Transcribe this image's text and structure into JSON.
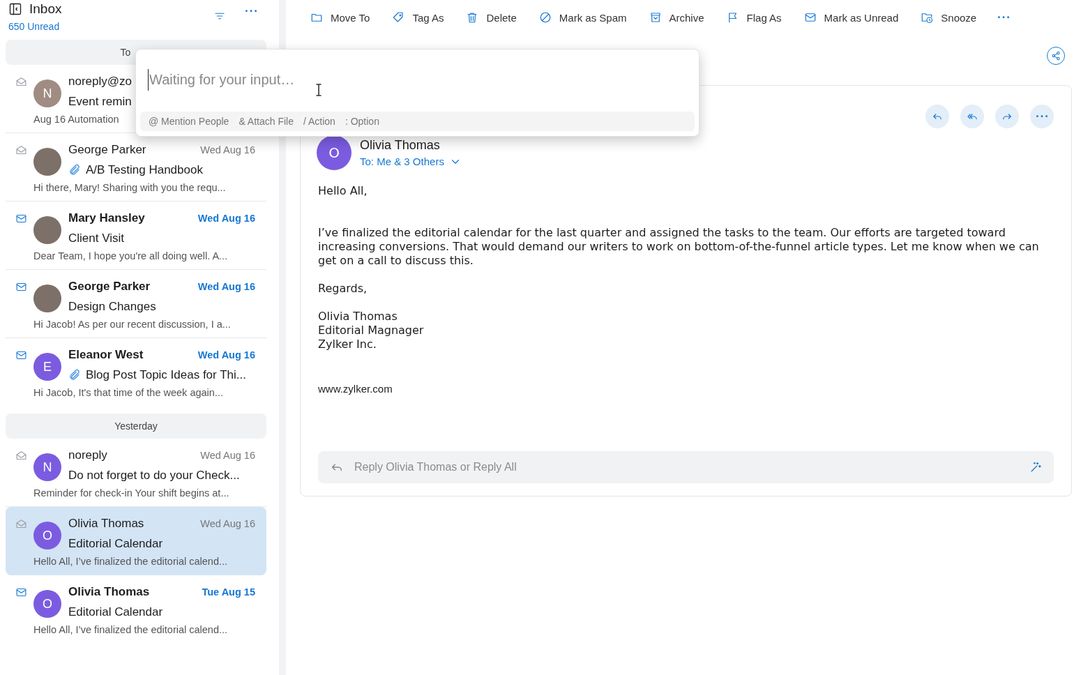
{
  "header": {
    "title": "Inbox",
    "unread": "650 Unread"
  },
  "groups": [
    {
      "label": "To",
      "emails": [
        {
          "sender": "noreply@zo",
          "subject": "Event remin",
          "preview": "Aug 16 Automation",
          "unread": false,
          "selected": false,
          "attachment": false,
          "avatar": {
            "kind": "initial",
            "initial": "N",
            "color": "#a08c82"
          }
        },
        {
          "sender": "George Parker",
          "date": "Wed Aug 16",
          "subject": "A/B Testing Handbook",
          "preview": "Hi there, Mary! Sharing with you the requ...",
          "unread": false,
          "selected": false,
          "attachment": true,
          "avatar": {
            "kind": "photo"
          }
        },
        {
          "sender": "Mary Hansley",
          "date": "Wed Aug 16",
          "subject": "Client Visit",
          "preview": "Dear Team, I hope you're all doing well. A...",
          "unread": true,
          "selected": false,
          "attachment": false,
          "avatar": {
            "kind": "photo"
          }
        },
        {
          "sender": "George Parker",
          "date": "Wed Aug 16",
          "subject": "Design Changes",
          "preview": "Hi Jacob! As per our recent discussion, I a...",
          "unread": true,
          "selected": false,
          "attachment": false,
          "avatar": {
            "kind": "photo"
          }
        },
        {
          "sender": "Eleanor West",
          "date": "Wed Aug 16",
          "subject": "Blog Post Topic Ideas for Thi...",
          "preview": "Hi Jacob, It's that time of the week again...",
          "unread": true,
          "selected": false,
          "attachment": true,
          "avatar": {
            "kind": "initial",
            "initial": "E",
            "color": "#7b5ce0"
          }
        }
      ]
    },
    {
      "label": "Yesterday",
      "emails": [
        {
          "sender": "noreply",
          "date": "Wed Aug 16",
          "subject": "Do not forget to do your Check...",
          "preview": "Reminder for check-in Your shift begins at...",
          "unread": false,
          "selected": false,
          "attachment": false,
          "avatar": {
            "kind": "initial",
            "initial": "N",
            "color": "#7b5ce0"
          }
        },
        {
          "sender": "Olivia Thomas",
          "date": "Wed Aug 16",
          "subject": "Editorial Calendar",
          "preview": "Hello All, I’ve finalized the editorial calend...",
          "unread": false,
          "selected": true,
          "attachment": false,
          "avatar": {
            "kind": "initial",
            "initial": "O",
            "color": "#7b5ce0"
          }
        },
        {
          "sender": "Olivia Thomas",
          "date": "Tue Aug 15",
          "subject": "Editorial Calendar",
          "preview": "Hello All, I’ve finalized the editorial calend...",
          "unread": true,
          "selected": false,
          "attachment": false,
          "avatar": {
            "kind": "initial",
            "initial": "O",
            "color": "#7b5ce0"
          }
        }
      ]
    }
  ],
  "toolbar": [
    "Move To",
    "Tag As",
    "Delete",
    "Mark as Spam",
    "Archive",
    "Flag As",
    "Mark as Unread",
    "Snooze"
  ],
  "popup": {
    "placeholder": "Waiting for your input…",
    "hints": [
      "@ Mention People",
      "& Attach File",
      "/ Action",
      ": Option"
    ]
  },
  "message": {
    "sender": "Olivia Thomas",
    "initial": "O",
    "recipients": "To: Me & 3 Others",
    "body": [
      "Hello All,",
      "I’ve finalized the editorial calendar for the last quarter and assigned the tasks to the team. Our efforts are targeted toward increasing conversions. That would demand our writers to work on bottom-of-the-funnel article types. Let me know when we can get on a call to discuss this.",
      "Regards,"
    ],
    "signature": [
      "Olivia Thomas",
      "Editorial Magnager",
      "Zylker Inc."
    ],
    "website": "www.zylker.com"
  },
  "reply": {
    "placeholder": "Reply Olivia Thomas or Reply All"
  }
}
